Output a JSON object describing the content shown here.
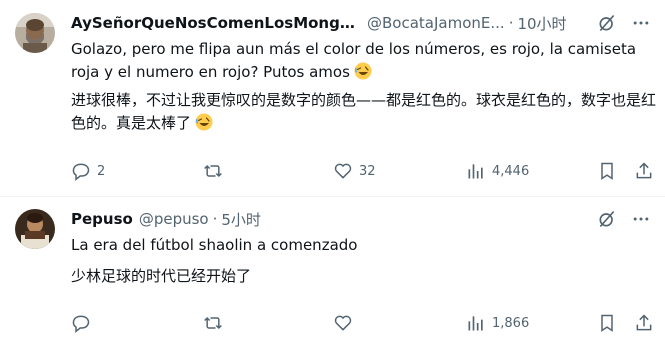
{
  "tweets": [
    {
      "author_name": "AySeñorQueNosComenLosMongu...",
      "handle": "@BocataJamonE...",
      "separator": "·",
      "time": "10小时",
      "text_original": "Golazo, pero me flipa aun más el color de los números, es rojo, la camiseta roja y el numero en rojo? Putos amos",
      "text_translated": "进球很棒，不过让我更惊叹的是数字的颜色——都是红色的。球衣是红色的，数字也是红色的。真是太棒了",
      "emoji": "rolling-on-floor-laughing",
      "replies": "2",
      "reposts": "",
      "likes": "32",
      "views": "4,446"
    },
    {
      "author_name": "Pepuso",
      "handle": "@pepuso",
      "separator": "·",
      "time": "5小时",
      "text_original": "La era del fútbol shaolin a comenzado",
      "text_translated": "少林足球的时代已经开始了",
      "replies": "",
      "reposts": "",
      "likes": "",
      "views": "1,866"
    }
  ],
  "colors": {
    "text": "#0f1419",
    "secondary": "#536471",
    "divider": "#eff3f4",
    "emoji_face": "#ffcc4d"
  },
  "icons": [
    "grok-icon",
    "more-icon",
    "reply-icon",
    "repost-icon",
    "like-icon",
    "views-icon",
    "bookmark-icon",
    "share-icon"
  ]
}
